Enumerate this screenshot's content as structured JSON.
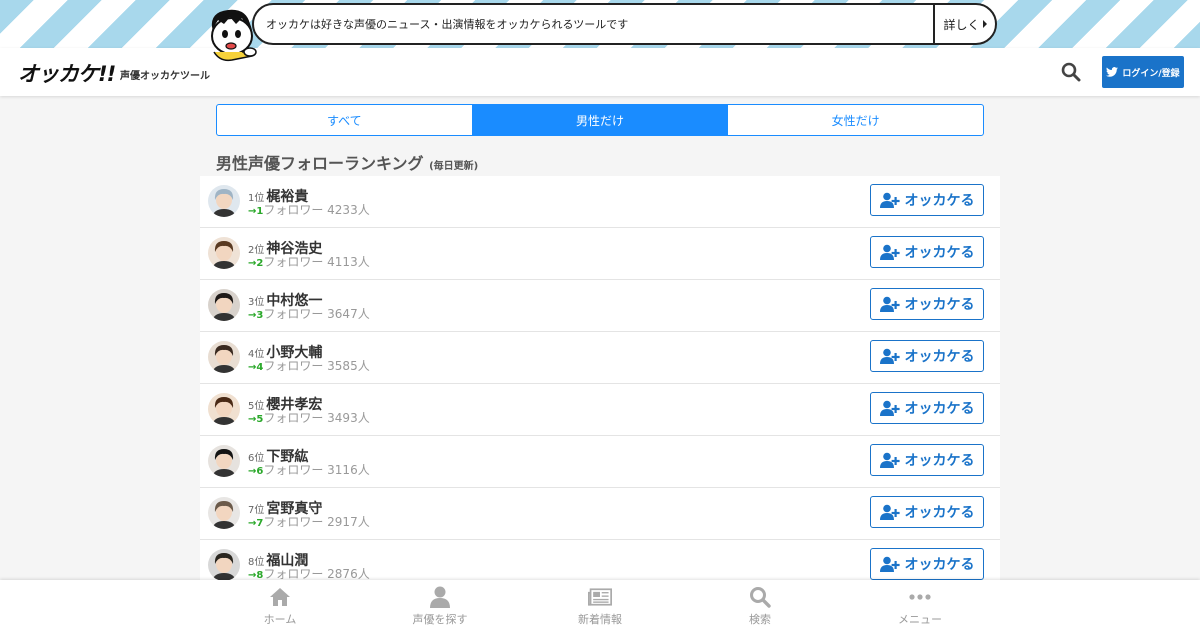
{
  "banner": {
    "message": "オッカケは好きな声優のニュース・出演情報をオッカケられるツールです",
    "more_label": "詳しく"
  },
  "header": {
    "logo": "オッカケ!!",
    "logo_sub": "声優オッカケツール",
    "login_label": "ログイン/登録"
  },
  "tabs": [
    {
      "label": "すべて",
      "active": false
    },
    {
      "label": "男性だけ",
      "active": true
    },
    {
      "label": "女性だけ",
      "active": false
    }
  ],
  "section": {
    "title": "男性声優フォローランキング",
    "note": "(毎日更新)"
  },
  "ranking": [
    {
      "rank": "1位",
      "name": "梶裕貴",
      "change": "→1",
      "followers": "フォロワー 4233人",
      "button": "オッカケる"
    },
    {
      "rank": "2位",
      "name": "神谷浩史",
      "change": "→2",
      "followers": "フォロワー 4113人",
      "button": "オッカケる"
    },
    {
      "rank": "3位",
      "name": "中村悠一",
      "change": "→3",
      "followers": "フォロワー 3647人",
      "button": "オッカケる"
    },
    {
      "rank": "4位",
      "name": "小野大輔",
      "change": "→4",
      "followers": "フォロワー 3585人",
      "button": "オッカケる"
    },
    {
      "rank": "5位",
      "name": "櫻井孝宏",
      "change": "→5",
      "followers": "フォロワー 3493人",
      "button": "オッカケる"
    },
    {
      "rank": "6位",
      "name": "下野紘",
      "change": "→6",
      "followers": "フォロワー 3116人",
      "button": "オッカケる"
    },
    {
      "rank": "7位",
      "name": "宮野真守",
      "change": "→7",
      "followers": "フォロワー 2917人",
      "button": "オッカケる"
    },
    {
      "rank": "8位",
      "name": "福山潤",
      "change": "→8",
      "followers": "フォロワー 2876人",
      "button": "オッカケる"
    }
  ],
  "bottom_nav": [
    {
      "label": "ホーム",
      "icon": "home-icon"
    },
    {
      "label": "声優を探す",
      "icon": "user-icon"
    },
    {
      "label": "新着情報",
      "icon": "newspaper-icon"
    },
    {
      "label": "検索",
      "icon": "search-icon"
    },
    {
      "label": "メニュー",
      "icon": "more-icon"
    }
  ],
  "colors": {
    "accent": "#1a8cff",
    "button_blue": "#1a73c9",
    "rank_change_green": "#2aa82a",
    "banner_stripe": "#a8d8ec"
  }
}
